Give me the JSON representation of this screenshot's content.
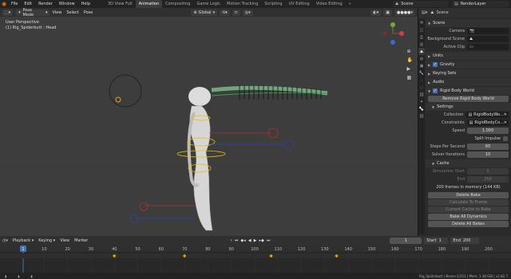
{
  "topbar": {
    "menus": [
      "File",
      "Edit",
      "Render",
      "Window",
      "Help"
    ],
    "workspaces": [
      "3D View Full",
      "Animation",
      "Compositing",
      "Game Logic",
      "Motion Tracking",
      "Scripting",
      "UV Editing",
      "Video Editing"
    ],
    "active_workspace": "Animation",
    "scene_label": "Scene",
    "layer_label": "RenderLayer"
  },
  "viewport_header": {
    "mode": "Pose Mode",
    "view": "View",
    "select": "Select",
    "pose": "Pose",
    "orientation": "Global"
  },
  "viewport": {
    "perspective": "User Perspective",
    "object_info": "(1) Rig_Spiderbutt : Head"
  },
  "properties": {
    "context": "Scene",
    "scene_panel": "Scene",
    "camera_label": "Camera",
    "bg_scene_label": "Background Scene",
    "active_clip_label": "Active Clip",
    "units": "Units",
    "gravity": "Gravity",
    "keying_sets": "Keying Sets",
    "audio": "Audio",
    "rigid_body_world": "Rigid Body World",
    "remove_rbw": "Remove Rigid Body World",
    "settings": "Settings",
    "collection_label": "Collection",
    "collection_value": "RigidBodyWo...",
    "constraints_label": "Constraints",
    "constraints_value": "RigidBodyCo...",
    "speed_label": "Speed",
    "speed_value": "1.000",
    "split_impulse": "Split Impulse",
    "steps_label": "Steps Per Second",
    "steps_value": "60",
    "solver_label": "Solver Iterations",
    "solver_value": "10",
    "cache": "Cache",
    "sim_start_label": "Simulation Start",
    "sim_start_value": "1",
    "end_label": "End",
    "end_value": "250",
    "frames_memory": "200 frames in memory (144 KB)",
    "delete_bake": "Delete Bake",
    "calc_to_frame": "Calculate To Frame",
    "current_cache_to_bake": "Current Cache to Bake",
    "bake_all_dynamics": "Bake All Dynamics",
    "delete_all_bakes": "Delete All Bakes"
  },
  "timeline_header": {
    "playback": "Playback",
    "keying": "Keying",
    "view": "View",
    "marker": "Marker",
    "current_frame": "1",
    "start_label": "Start",
    "start_value": "1",
    "end_label": "End",
    "end_value": "200"
  },
  "timeline": {
    "ticks": [
      "1",
      "10",
      "20",
      "30",
      "40",
      "50",
      "60",
      "70",
      "80",
      "90",
      "100",
      "110",
      "120",
      "130",
      "140",
      "150",
      "160",
      "170",
      "180",
      "190",
      "200"
    ],
    "keyframes": [
      40,
      70,
      107,
      135
    ]
  },
  "statusbar": {
    "text": "Rig_Spiderbutt | Bones:1/351 | Mem: 1.38 GiB | v2.82.7"
  },
  "colors": {
    "accent": "#4772b3",
    "active_ws": "#3c3c3c",
    "viewport_bg": "#3d3d3d",
    "blender_orange": "#e87d0d"
  }
}
